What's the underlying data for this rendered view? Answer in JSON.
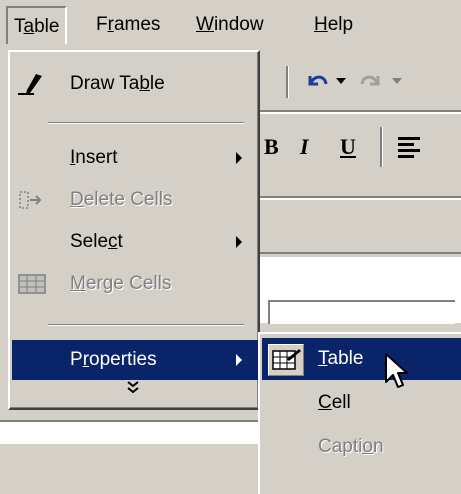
{
  "menubar": {
    "items": [
      {
        "label_pre": "T",
        "accel": "a",
        "label_post": "ble"
      },
      {
        "label_pre": "F",
        "accel": "r",
        "label_post": "ames"
      },
      {
        "label_pre": "",
        "accel": "W",
        "label_post": "indow"
      },
      {
        "label_pre": "",
        "accel": "H",
        "label_post": "elp"
      }
    ]
  },
  "table_menu": {
    "draw_table": {
      "pre": "Draw Ta",
      "accel": "b",
      "post": "le"
    },
    "insert": {
      "pre": "",
      "accel": "I",
      "post": "nsert"
    },
    "delete_cells": {
      "pre": "",
      "accel": "D",
      "post": "elete Cells"
    },
    "select": {
      "pre": "Sele",
      "accel": "c",
      "post": "t"
    },
    "merge_cells": {
      "pre": "",
      "accel": "M",
      "post": "erge Cells"
    },
    "properties": {
      "pre": "P",
      "accel": "r",
      "post": "operties"
    },
    "expand": "»"
  },
  "properties_submenu": {
    "table": {
      "pre": "",
      "accel": "T",
      "post": "able"
    },
    "cell": {
      "pre": "",
      "accel": "C",
      "post": "ell"
    },
    "caption": {
      "pre": "Capti",
      "accel": "o",
      "post": "n"
    }
  },
  "toolbar": {
    "bold": "B",
    "italic": "I",
    "underline": "U"
  }
}
